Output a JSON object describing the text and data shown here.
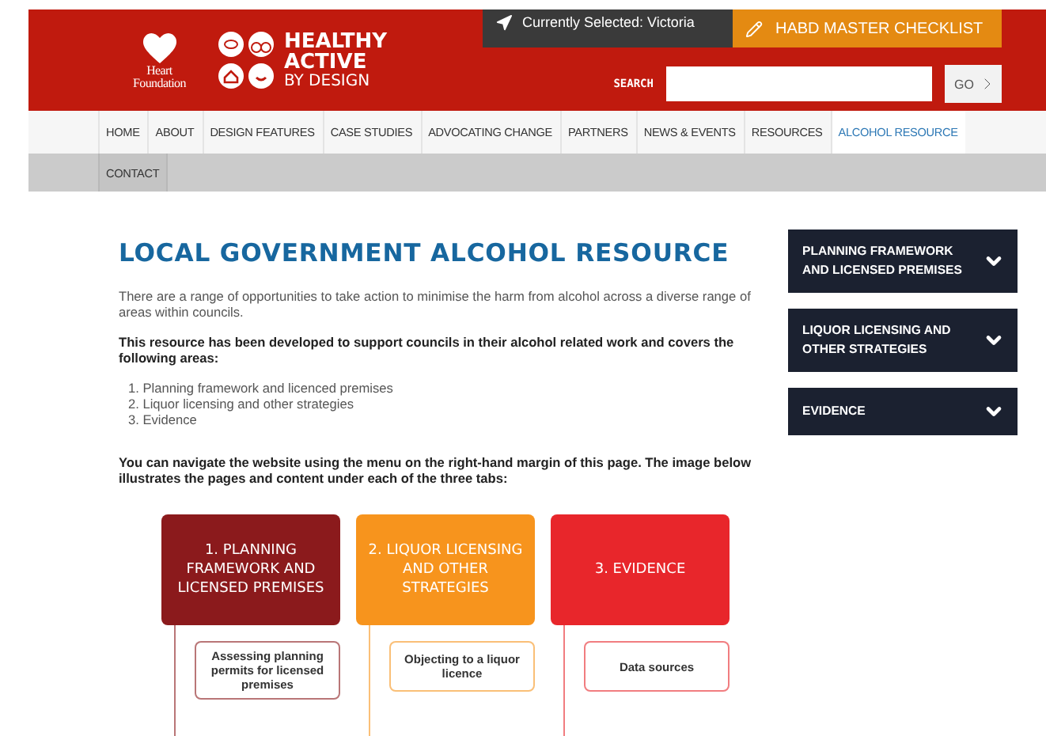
{
  "header": {
    "heart_logo": [
      "Heart",
      "Foundation"
    ],
    "brand": [
      "HEALTHY",
      "ACTIVE",
      "BY DESIGN"
    ],
    "location": "Currently Selected: Victoria",
    "checklist": "HABD MASTER CHECKLIST",
    "search": {
      "label": "SEARCH",
      "button": "GO"
    }
  },
  "nav": {
    "rows": [
      [
        {
          "label": "HOME",
          "selected": false
        },
        {
          "label": "ABOUT",
          "selected": false
        },
        {
          "label": "DESIGN FEATURES",
          "selected": false
        },
        {
          "label": "CASE STUDIES",
          "selected": false
        },
        {
          "label": "ADVOCATING CHANGE",
          "selected": false
        },
        {
          "label": "PARTNERS",
          "selected": false
        },
        {
          "label": "NEWS & EVENTS",
          "selected": false
        },
        {
          "label": "RESOURCES",
          "selected": false
        },
        {
          "label": "ALCOHOL RESOURCE",
          "selected": true
        }
      ],
      [
        {
          "label": "CONTACT",
          "selected": false
        }
      ]
    ]
  },
  "main": {
    "title": "LOCAL GOVERNMENT ALCOHOL RESOURCE",
    "intro": "There are a range of opportunities to take action to minimise the harm from alcohol across a diverse range of areas within councils.",
    "lead": "This resource has been developed to support councils in their alcohol related work and covers the following areas:",
    "areas": [
      "1. Planning framework and licenced premises",
      "2. Liquor licensing and other strategies",
      "3. Evidence"
    ],
    "note": "You can navigate the website using the menu on the right-hand margin of this page. The image below illustrates the pages and content under each of the three tabs:",
    "diagram": {
      "columns": [
        {
          "heading": "1. PLANNING FRAMEWORK AND LICENSED PREMISES",
          "color": "#8b1a1c",
          "children": [
            {
              "label": "Assessing planning permits for licensed premises"
            }
          ]
        },
        {
          "heading": "2. LIQUOR LICENSING AND OTHER STRATEGIES",
          "color": "#f7941d",
          "children": [
            {
              "label": "Objecting to a liquor licence"
            }
          ]
        },
        {
          "heading": "3. EVIDENCE",
          "color": "#e8262b",
          "children": [
            {
              "label": "Data sources"
            }
          ]
        }
      ]
    }
  },
  "sidebar": [
    {
      "label": "PLANNING FRAMEWORK AND LICENSED PREMISES",
      "expanded": false
    },
    {
      "label": "LIQUOR LICENSING AND OTHER STRATEGIES",
      "expanded": false
    },
    {
      "label": "EVIDENCE",
      "expanded": false
    }
  ]
}
